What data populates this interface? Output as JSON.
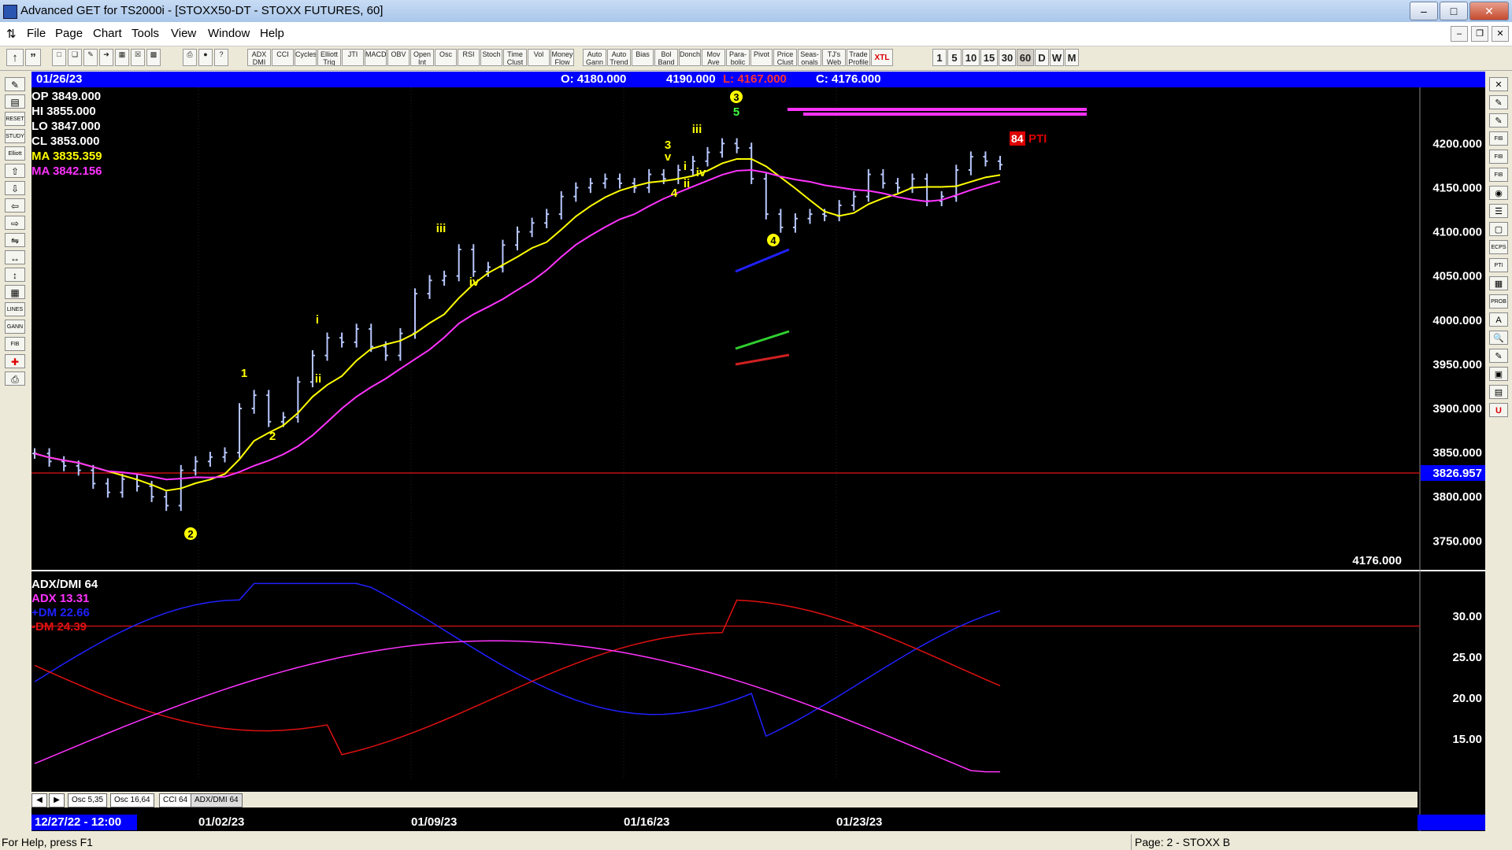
{
  "window": {
    "title": "Advanced GET for TS2000i - [STOXX50-DT - STOXX FUTURES, 60]"
  },
  "menu": [
    "File",
    "Page",
    "Chart",
    "Tools",
    "View",
    "Window",
    "Help"
  ],
  "toolbar": {
    "indicators": [
      "ADX DMI",
      "CCI",
      "Cycles",
      "Elliott Trig",
      "JTI",
      "MACD",
      "OBV",
      "Open Int",
      "Osc",
      "RSI",
      "Stoch",
      "Time Clust",
      "Vol",
      "Money Flow",
      "Auto Gann",
      "Auto Trend",
      "Bias",
      "Bol Band",
      "Donch",
      "Mov Ave",
      "Para-bolic",
      "Pivot",
      "Price Clust",
      "Seas-onals",
      "TJ's Web",
      "Trade Profile",
      "XTL"
    ],
    "intervals": [
      "1",
      "5",
      "10",
      "15",
      "30",
      "60",
      "D",
      "W",
      "M"
    ]
  },
  "left_tools": [
    "RESET",
    "STUDY",
    "Elliott",
    "LINES",
    "GANN",
    "FIB"
  ],
  "right_tools": [
    "FIB RET",
    "FIB EXT",
    "FIB TIME",
    "ECPS",
    "PTI",
    "PROB"
  ],
  "header": {
    "date": "01/26/23",
    "open": "O: 4180.000",
    "high": "4190.000",
    "low": "L: 4167.000",
    "close": "C: 4176.000"
  },
  "info": {
    "op": "OP  3849.000",
    "hi": "HI   3855.000",
    "lo": "LO   3847.000",
    "cl": "CL   3853.000",
    "ma1": "MA  3835.359",
    "ma2": "MA  3842.156"
  },
  "price_axis": [
    "4200.000",
    "4150.000",
    "4100.000",
    "4050.000",
    "4000.000",
    "3950.000",
    "3900.000",
    "3850.000",
    "3800.000",
    "3750.000"
  ],
  "price_marker": "3826.957",
  "last_price": "4176.000",
  "pti": {
    "value": "84",
    "label": "PTI"
  },
  "indicator_panel": {
    "title": "ADX/DMI 64",
    "adx": "ADX 13.31",
    "pdm": "+DM 22.66",
    "mdm": "-DM  24.39",
    "axis": [
      "30.00",
      "25.00",
      "20.00",
      "15.00"
    ]
  },
  "tabs": [
    "Osc 5,35",
    "Osc 16,64",
    "CCI 64",
    "ADX/DMI 64"
  ],
  "dates": [
    "12/27/22 - 12:00",
    "01/02/23",
    "01/09/23",
    "01/16/23",
    "01/23/23"
  ],
  "status": {
    "help": "For Help, press F1",
    "page": "Page: 2 - STOXX B"
  },
  "wave_labels": [
    "1",
    "2",
    "i",
    "ii",
    "iii",
    "iv",
    "3",
    "v",
    "4",
    "i",
    "ii",
    "iii",
    "iv",
    "5",
    "3",
    "4",
    "2"
  ],
  "colors": {
    "bg": "#000000",
    "ma_fast": "#ffff00",
    "ma_slow": "#ff33ff",
    "bar_blue": "#0000ff",
    "pdm": "#2020ff",
    "mdm": "#e01010",
    "adx": "#ff33ff"
  },
  "chart_data": {
    "type": "line",
    "title": "",
    "ylim": [
      3720,
      4260
    ],
    "x_dates": [
      "12/27/22",
      "01/02/23",
      "01/09/23",
      "01/16/23",
      "01/23/23",
      "01/26/23"
    ],
    "series": [
      {
        "name": "",
        "values": [
          3849,
          3840,
          3835,
          3830,
          3815,
          3805,
          3820,
          3812,
          3800,
          3790,
          3830,
          3840,
          3845,
          3850,
          3900,
          3915,
          3885,
          3890,
          3930,
          3960,
          3980,
          3975,
          3990,
          3970,
          3960,
          3985,
          4030,
          4045,
          4050,
          4080,
          4055,
          4060,
          4085,
          4100,
          4110,
          4120,
          4140,
          4150,
          4155,
          4160,
          4155,
          4150,
          4165,
          4160,
          4170,
          4180,
          4190,
          4200,
          4195,
          4160,
          4120,
          4105,
          4115,
          4120,
          4118,
          4130,
          4140,
          4165,
          4155,
          4150,
          4160,
          4135,
          4140,
          4170,
          4185,
          4180,
          4176
        ]
      }
    ]
  }
}
